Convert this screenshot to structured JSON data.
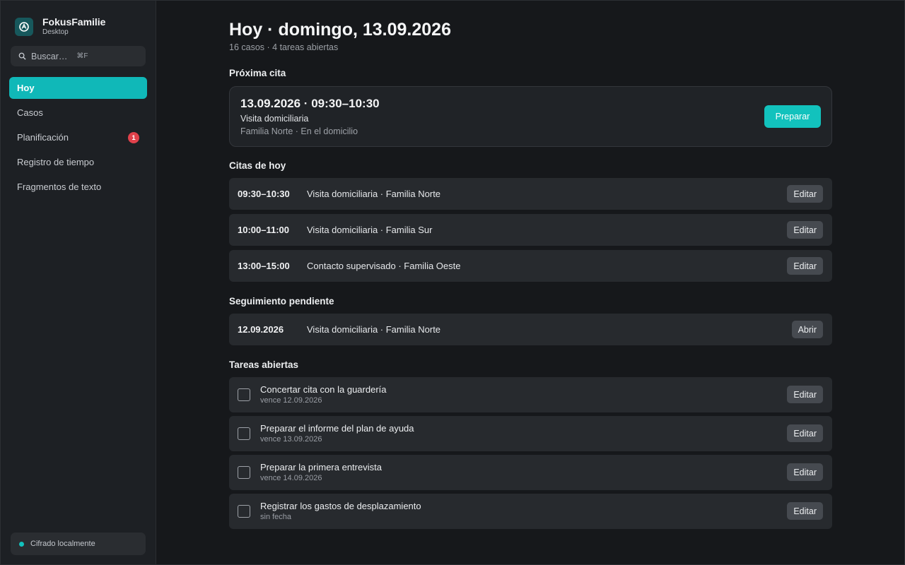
{
  "app": {
    "name": "FokusFamilie",
    "subtitle": "Desktop"
  },
  "search": {
    "placeholder": "Buscar…",
    "shortcut": "⌘F"
  },
  "sidebar": {
    "items": [
      {
        "label": "Hoy",
        "active": true
      },
      {
        "label": "Casos"
      },
      {
        "label": "Planificación",
        "badge": "1"
      },
      {
        "label": "Registro de tiempo"
      },
      {
        "label": "Fragmentos de texto"
      }
    ],
    "encryption": "Cifrado localmente"
  },
  "header": {
    "title": "Hoy · domingo, 13.09.2026",
    "subtitle": "16 casos · 4 tareas abiertas"
  },
  "next_appointment": {
    "section": "Próxima cita",
    "time": "13.09.2026 · 09:30–10:30",
    "type": "Visita domiciliaria",
    "location": "Familia Norte · En el domicilio",
    "button": "Preparar"
  },
  "today": {
    "section": "Citas de hoy",
    "items": [
      {
        "time": "09:30–10:30",
        "desc": "Visita domiciliaria · Familia Norte",
        "button": "Editar"
      },
      {
        "time": "10:00–11:00",
        "desc": "Visita domiciliaria · Familia Sur",
        "button": "Editar"
      },
      {
        "time": "13:00–15:00",
        "desc": "Contacto supervisado · Familia Oeste",
        "button": "Editar"
      }
    ]
  },
  "followup": {
    "section": "Seguimiento pendiente",
    "items": [
      {
        "time": "12.09.2026",
        "desc": "Visita domiciliaria · Familia Norte",
        "button": "Abrir"
      }
    ]
  },
  "tasks": {
    "section": "Tareas abiertas",
    "items": [
      {
        "title": "Concertar cita con la guardería",
        "due": "vence 12.09.2026",
        "button": "Editar"
      },
      {
        "title": "Preparar el informe del plan de ayuda",
        "due": "vence 13.09.2026",
        "button": "Editar"
      },
      {
        "title": "Preparar la primera entrevista",
        "due": "vence 14.09.2026",
        "button": "Editar"
      },
      {
        "title": "Registrar los gastos de desplazamiento",
        "due": "sin fecha",
        "button": "Editar"
      }
    ]
  },
  "colors": {
    "accent": "#12c2bd",
    "badge": "#e0414b",
    "background": "#16181b",
    "sidebar": "#1d2024"
  },
  "icons": {
    "logo": "app-logo-icon",
    "search": "search-icon",
    "status": "status-dot-icon"
  }
}
